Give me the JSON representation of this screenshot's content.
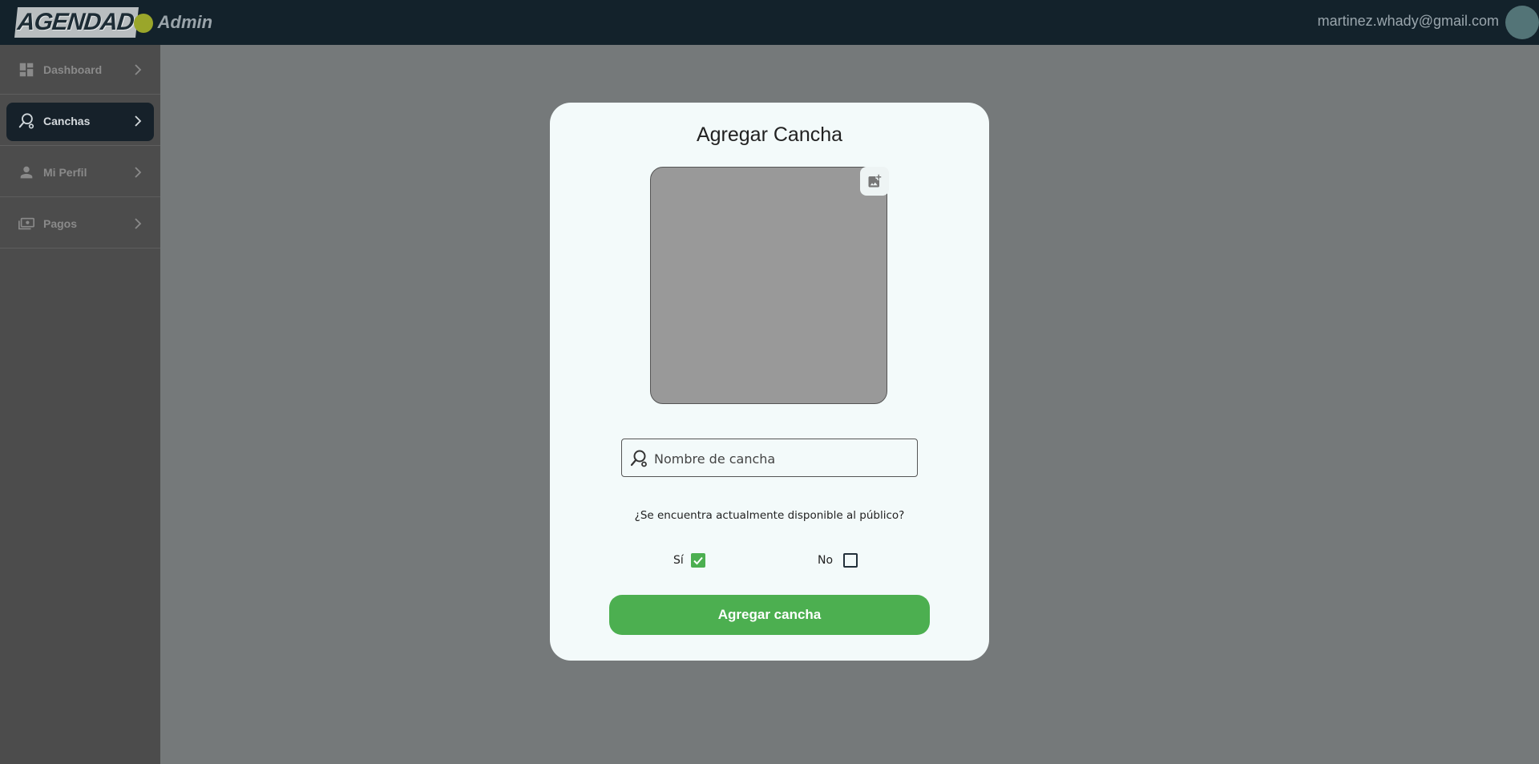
{
  "header": {
    "logo_text": "AGENDAD",
    "logo_suffix": "Admin",
    "user_email": "martinez.whady@gmail.com"
  },
  "sidebar": {
    "items": [
      {
        "label": "Dashboard",
        "icon": "dashboard-icon",
        "active": false
      },
      {
        "label": "Canchas",
        "icon": "field-search-icon",
        "active": true
      },
      {
        "label": "Mi Perfil",
        "icon": "person-icon",
        "active": false
      },
      {
        "label": "Pagos",
        "icon": "payments-icon",
        "active": false
      }
    ]
  },
  "modal": {
    "title": "Agregar Cancha",
    "image_button_icon": "add-photo-icon",
    "name_placeholder": "Nombre de cancha",
    "name_value": "",
    "availability_question": "¿Se encuentra actualmente disponible al público?",
    "option_yes": "Sí",
    "option_no": "No",
    "yes_checked": true,
    "no_checked": false,
    "submit_label": "Agregar cancha"
  },
  "colors": {
    "topbar": "#13222b",
    "sidebar": "#4c4c4c",
    "overlay": "#75797a",
    "accent_green": "#4caf50",
    "modal_bg": "#f3fafa"
  }
}
